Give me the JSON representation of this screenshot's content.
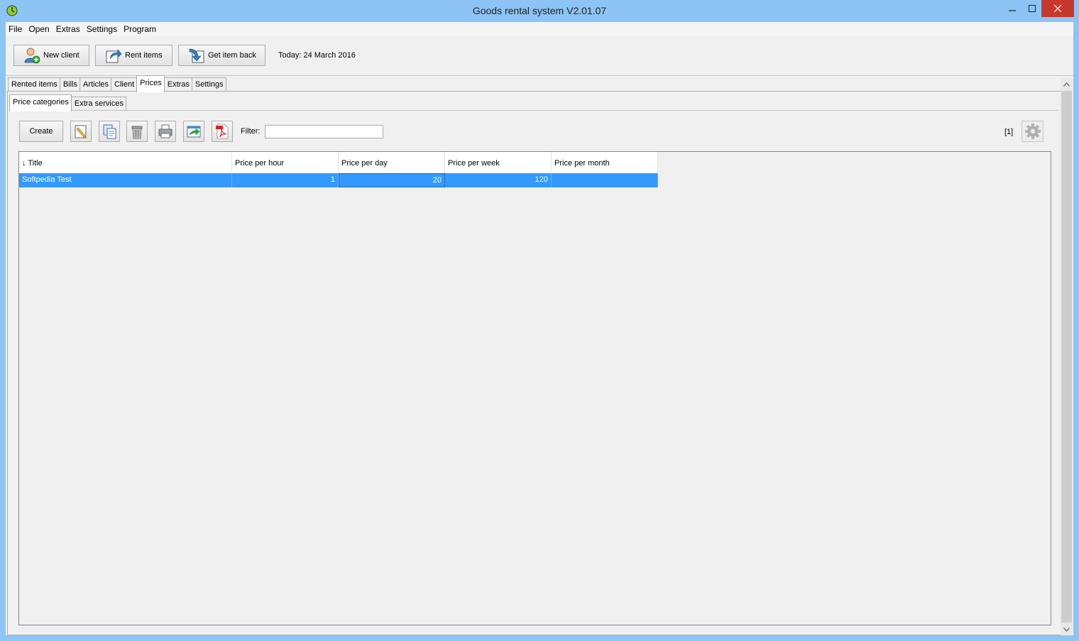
{
  "window": {
    "title": "Goods rental system V2.01.07"
  },
  "menu": [
    "File",
    "Open",
    "Extras",
    "Settings",
    "Program"
  ],
  "toolbar": {
    "new_client": "New client",
    "rent_items": "Rent items",
    "get_item_back": "Get item back",
    "today": "Today: 24 March 2016"
  },
  "main_tabs": [
    "Rented items",
    "Bills",
    "Articles",
    "Client",
    "Prices",
    "Extras",
    "Settings"
  ],
  "active_main_tab": "Prices",
  "sub_tabs": [
    "Price categories",
    "Extra services"
  ],
  "active_sub_tab": "Price categories",
  "price_toolbar": {
    "create_label": "Create",
    "filter_label": "Filter:",
    "filter_value": "",
    "record_count": "[1]",
    "icons": [
      "edit-icon",
      "copy-icon",
      "delete-icon",
      "print-icon",
      "export-icon",
      "pdf-icon",
      "gear-icon"
    ]
  },
  "table": {
    "columns": [
      "↓ Title",
      "Price per hour",
      "Price per day",
      "Price per week",
      "Price per month"
    ],
    "rows": [
      {
        "title": "Softpedia Test",
        "hour": "1",
        "day": "20",
        "week": "120",
        "month": ""
      }
    ]
  },
  "colors": {
    "title_bar": "#8cc4f5",
    "selection": "#3399ff",
    "close_button": "#c7382c"
  }
}
